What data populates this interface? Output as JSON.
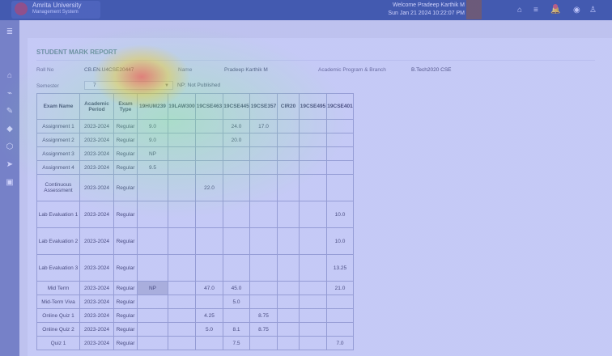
{
  "app": {
    "name": "Amrita University",
    "subtitle": "Management System"
  },
  "header": {
    "welcome": "Welcome Pradeep Karthik M",
    "datetime": "Sun Jan 21 2024 10:22:07 PM"
  },
  "report": {
    "title": "STUDENT MARK REPORT",
    "roll_label": "Roll No",
    "roll_value": "CB.EN.U4CSE20447",
    "name_label": "Name",
    "name_value": "Pradeep Karthik M",
    "program_label": "Academic Program & Branch",
    "program_value": "B.Tech2020 CSE",
    "semester_label": "Semester",
    "semester_value": "7",
    "np_note": "NP: Not Published"
  },
  "table": {
    "headers": [
      "Exam Name",
      "Academic Period",
      "Exam Type",
      "19HUM239",
      "19LAW300",
      "19CSE463",
      "19CSE445",
      "19CSE357",
      "CIR20",
      "19CSE495",
      "19CSE401"
    ],
    "rows": [
      [
        "Assignment 1",
        "2023-2024",
        "Regular",
        "9.0",
        "",
        "",
        "24.0",
        "17.0",
        "",
        "",
        ""
      ],
      [
        "Assignment 2",
        "2023-2024",
        "Regular",
        "9.0",
        "",
        "",
        "20.0",
        "",
        "",
        "",
        ""
      ],
      [
        "Assignment 3",
        "2023-2024",
        "Regular",
        "NP",
        "",
        "",
        "",
        "",
        "",
        "",
        ""
      ],
      [
        "Assignment 4",
        "2023-2024",
        "Regular",
        "9.5",
        "",
        "",
        "",
        "",
        "",
        "",
        ""
      ],
      [
        "Continuous Assessment",
        "2023-2024",
        "Regular",
        "",
        "",
        "22.0",
        "",
        "",
        "",
        "",
        ""
      ],
      [
        "Lab Evaluation 1",
        "2023-2024",
        "Regular",
        "",
        "",
        "",
        "",
        "",
        "",
        "",
        "10.0"
      ],
      [
        "Lab Evaluation 2",
        "2023-2024",
        "Regular",
        "",
        "",
        "",
        "",
        "",
        "",
        "",
        "10.0"
      ],
      [
        "Lab Evaluation 3",
        "2023-2024",
        "Regular",
        "",
        "",
        "",
        "",
        "",
        "",
        "",
        "13.25"
      ],
      [
        "Mid Term",
        "2023-2024",
        "Regular",
        "NP",
        "",
        "47.0",
        "45.0",
        "",
        "",
        "",
        "21.0"
      ],
      [
        "Mid-Term Viva",
        "2023-2024",
        "Regular",
        "",
        "",
        "",
        "5.0",
        "",
        "",
        "",
        ""
      ],
      [
        "Online Quiz 1",
        "2023-2024",
        "Regular",
        "",
        "",
        "4.25",
        "",
        "8.75",
        "",
        "",
        ""
      ],
      [
        "Online Quiz 2",
        "2023-2024",
        "Regular",
        "",
        "",
        "5.0",
        "8.1",
        "8.75",
        "",
        "",
        ""
      ],
      [
        "Quiz 1",
        "2023-2024",
        "Regular",
        "",
        "",
        "",
        "7.5",
        "",
        "",
        "",
        "7.0"
      ]
    ]
  },
  "icons": {
    "home": "home-icon",
    "menu": "menu-icon",
    "notifications": "bell-icon",
    "globe": "globe-icon",
    "user": "user-icon"
  },
  "colors": {
    "topbar": "#2c4a8e",
    "sidebar": "#7b86b3",
    "title_green": "#6b9a7a"
  }
}
